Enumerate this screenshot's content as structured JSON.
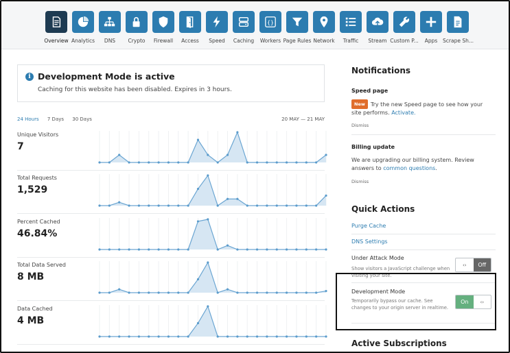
{
  "nav": {
    "items": [
      {
        "label": "Overview",
        "icon": "document-icon",
        "active": true
      },
      {
        "label": "Analytics",
        "icon": "pie-chart-icon",
        "active": false
      },
      {
        "label": "DNS",
        "icon": "network-icon",
        "active": false
      },
      {
        "label": "Crypto",
        "icon": "lock-icon",
        "active": false
      },
      {
        "label": "Firewall",
        "icon": "shield-icon",
        "active": false
      },
      {
        "label": "Access",
        "icon": "door-icon",
        "active": false
      },
      {
        "label": "Speed",
        "icon": "lightning-icon",
        "active": false
      },
      {
        "label": "Caching",
        "icon": "server-icon",
        "active": false
      },
      {
        "label": "Workers",
        "icon": "code-braces-icon",
        "active": false
      },
      {
        "label": "Page Rules",
        "icon": "funnel-icon",
        "active": false
      },
      {
        "label": "Network",
        "icon": "location-pin-icon",
        "active": false
      },
      {
        "label": "Traffic",
        "icon": "list-icon",
        "active": false
      },
      {
        "label": "Stream",
        "icon": "cloud-upload-icon",
        "active": false
      },
      {
        "label": "Custom P...",
        "icon": "wrench-icon",
        "active": false
      },
      {
        "label": "Apps",
        "icon": "plus-icon",
        "active": false
      },
      {
        "label": "Scrape Sh...",
        "icon": "file-icon",
        "active": false
      }
    ]
  },
  "banner": {
    "title": "Development Mode is active",
    "description": "Caching for this website has been disabled. Expires in 3 hours."
  },
  "range": {
    "tabs": [
      "24 Hours",
      "7 Days",
      "30 Days"
    ],
    "active_index": 0,
    "date_range": "20 MAY — 21 MAY"
  },
  "metrics": [
    {
      "label": "Unique Visitors",
      "value": "7",
      "series": [
        0,
        0,
        1,
        0,
        0,
        0,
        0,
        0,
        0,
        0,
        3,
        1,
        0,
        1,
        4,
        0,
        0,
        0,
        0,
        0,
        0,
        0,
        0,
        1
      ]
    },
    {
      "label": "Total Requests",
      "value": "1,529",
      "series": [
        0,
        0,
        1,
        0,
        0,
        0,
        0,
        0,
        0,
        0,
        5,
        9,
        0,
        2,
        2,
        0,
        0,
        0,
        0,
        0,
        0,
        0,
        0,
        3
      ]
    },
    {
      "label": "Percent Cached",
      "value": "46.84%",
      "series": [
        0,
        0,
        0,
        0,
        0,
        0,
        0,
        0,
        0,
        0,
        7,
        7.5,
        0,
        1,
        0,
        0,
        0,
        0,
        0,
        0,
        0,
        0,
        0,
        0
      ]
    },
    {
      "label": "Total Data Served",
      "value": "8 MB",
      "series": [
        0,
        0,
        1,
        0,
        0,
        0,
        0,
        0,
        0,
        0,
        4,
        9,
        0,
        1,
        0,
        0,
        0,
        0,
        0,
        0,
        0,
        0,
        0,
        0.5
      ]
    },
    {
      "label": "Data Cached",
      "value": "4 MB",
      "series": [
        0,
        0,
        0,
        0,
        0,
        0,
        0,
        0,
        0,
        0,
        4,
        9,
        0,
        0,
        0,
        0,
        0,
        0,
        0,
        0,
        0,
        0,
        0,
        0
      ]
    }
  ],
  "notifications": {
    "heading": "Notifications",
    "items": [
      {
        "title": "Speed page",
        "badge": "New",
        "text": "Try the new Speed page to see how your site performs.",
        "link": "Activate.",
        "dismiss": "Dismiss"
      },
      {
        "title": "Billing update",
        "text": "We are upgrading our billing system. Review answers to",
        "link": "common questions",
        "text_after": ".",
        "dismiss": "Dismiss"
      }
    ]
  },
  "quick_actions": {
    "heading": "Quick Actions",
    "purge_cache": "Purge Cache",
    "dns_settings": "DNS Settings",
    "under_attack": {
      "title": "Under Attack Mode",
      "desc": "Show visitors a JavaScript challenge when visiting your site.",
      "state": "Off"
    },
    "dev_mode": {
      "title": "Development Mode",
      "desc": "Temporarily bypass our cache. See changes to your origin server in realtime.",
      "state": "On"
    }
  },
  "subscriptions": {
    "heading": "Active Subscriptions"
  },
  "colors": {
    "accent": "#2c7cb0",
    "nav_active": "#1e3b52",
    "toggle_on": "#65b07f",
    "toggle_off": "#666666",
    "badge_new": "#e06d2b"
  },
  "toggle_glyph": "‹›"
}
